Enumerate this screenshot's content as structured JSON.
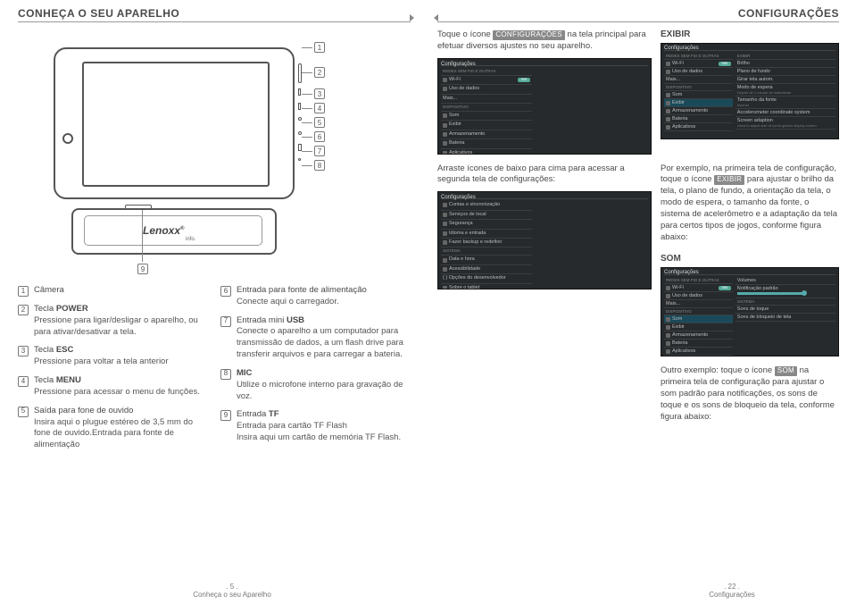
{
  "left": {
    "header": "CONHEÇA O SEU APARELHO",
    "logo_brand": "Lenoxx",
    "logo_sub": "info.",
    "callouts": [
      "1",
      "2",
      "3",
      "4",
      "5",
      "6",
      "7",
      "8",
      "9"
    ],
    "legend": [
      {
        "n": "1",
        "title": "Câmera",
        "desc": ""
      },
      {
        "n": "2",
        "title": "Tecla POWER",
        "desc": "Pressione para ligar/desligar o aparelho, ou para ativar/desativar a tela."
      },
      {
        "n": "3",
        "title": "Tecla ESC",
        "desc": "Pressione para voltar a tela anterior"
      },
      {
        "n": "4",
        "title": "Tecla MENU",
        "desc": "Pressione para acessar o menu de funções."
      },
      {
        "n": "5",
        "title": "Saída para fone de ouvido",
        "desc": "Insira aqui o plugue estéreo de 3,5 mm do fone de ouvido.Entrada para fonte de alimentação"
      },
      {
        "n": "6",
        "title": "Entrada para fonte de alimentação",
        "desc": "Conecte aqui o carregador."
      },
      {
        "n": "7",
        "title": "Entrada mini USB",
        "desc": "Conecte o aparelho a um computador para transmissão de dados, a um flash drive para transferir arquivos e para carregar a bateria."
      },
      {
        "n": "8",
        "title": "MIC",
        "desc": "Utilize o microfone interno para gravação de voz."
      },
      {
        "n": "9",
        "title": "Entrada TF",
        "desc": "Entrada para cartão TF Flash",
        "desc2": "Insira aqui um cartão de memória TF Flash."
      }
    ],
    "footer_page": ". 5 .",
    "footer_title": "Conheça o seu Aparelho"
  },
  "right": {
    "header": "CONFIGURAÇÕES",
    "intro_pre": "Toque o ícone ",
    "intro_chip": "CONFIGURAÇÕES",
    "intro_post": " na tela principal para efetuar diversos ajustes no seu aparelho.",
    "scroll_text": "Arraste ícones de baixo para cima para acessar a segunda tela de configurações:",
    "exibir_head": "EXIBIR",
    "exibir_text_pre": "Por exemplo, na primeira tela de configuração, toque o ícone ",
    "exibir_chip": "EXIBIR",
    "exibir_text_post": " para ajustar o brilho da tela, o plano de fundo, a orientação da tela, o modo de espera, o tamanho da fonte, o sistema de acelerômetro e a adaptação da tela para certos tipos de jogos, conforme figura abaixo:",
    "som_head": "SOM",
    "som_text_pre": "Outro exemplo: toque o ícone ",
    "som_chip": "SOM",
    "som_text_post": " na primeira tela de configuração para ajustar o som padrão para notificações, os sons de toque e os sons de bloqueio da tela, conforme figura abaixo:",
    "footer_page": ". 22 .",
    "footer_title": "Configurações",
    "shot1": {
      "title": "Configurações",
      "group1": "REDES SEM FIO E OUTRAS",
      "items_left": [
        "Wi-Fi",
        "Uso de dados",
        "Mais..."
      ],
      "group2": "DISPOSITIVO",
      "items_left2": [
        "Som",
        "Exibir",
        "Armazenamento",
        "Bateria",
        "Aplicativos"
      ],
      "toggle": "SIM",
      "note": ""
    },
    "shot2": {
      "title": "Configurações",
      "items_left": [
        "Contas e sincronização",
        "Serviços de local",
        "Segurança",
        "Idioma e entrada",
        "Fazer backup e redefinir"
      ],
      "group2": "SISTEMA",
      "items_left2": [
        "Acessibilidade",
        "{ } Opções do desenvolvedor",
        "Data e hora",
        "Sobre o tablet"
      ]
    },
    "shot_exibir": {
      "title": "Configurações",
      "left_items": [
        "Wi-Fi",
        "Uso de dados",
        "Mais...",
        "Som",
        "Exibir",
        "Armazenamento",
        "Bateria",
        "Aplicativos"
      ],
      "right_head": "EXIBIR",
      "right_items": [
        "Brilho",
        "Plano de fundo",
        "Girar tela autom.",
        "Modo de espera",
        "Tamanho da fonte",
        "Accelerometer coordinate system",
        "Screen adaption"
      ],
      "right_subs": [
        "",
        "",
        "",
        "Depois de 1 minuto de inatividade",
        "Normal",
        "",
        "Used to adjust size of some games display screen"
      ]
    },
    "shot_som": {
      "title": "Configurações",
      "left_items": [
        "Wi-Fi",
        "Uso de dados",
        "Mais...",
        "Som",
        "Exibir",
        "Armazenamento",
        "Bateria",
        "Aplicativos"
      ],
      "right_head": "Volumes",
      "right_items": [
        "Notificação padrão",
        "Sons de toque",
        "Sons de bloqueio de tela"
      ],
      "right_group2": "SISTEMA"
    }
  }
}
